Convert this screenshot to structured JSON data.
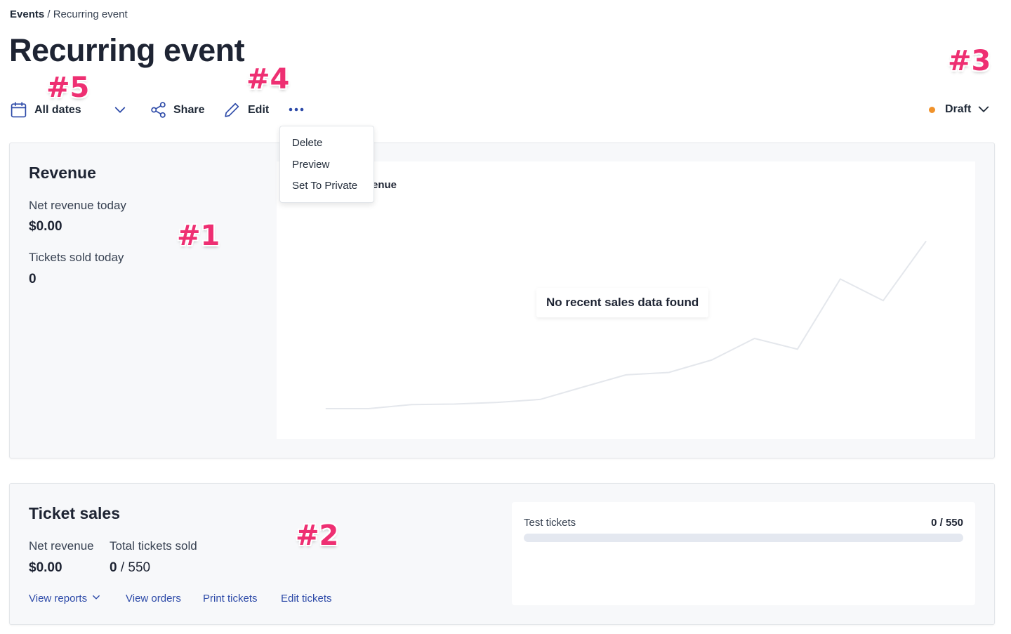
{
  "breadcrumb": {
    "root": "Events",
    "separator": " / ",
    "current": "Recurring event"
  },
  "page": {
    "title": "Recurring event"
  },
  "toolbar": {
    "dates_label": "All dates",
    "share_label": "Share",
    "edit_label": "Edit",
    "more_icon": "ellipsis-icon",
    "status_label": "Draft",
    "status_color": "#f0922b"
  },
  "more_menu": {
    "items": [
      "Delete",
      "Preview",
      "Set To Private"
    ]
  },
  "markers": {
    "m1": "#1",
    "m2": "#2",
    "m3": "#3",
    "m4": "#4",
    "m5": "#5"
  },
  "revenue": {
    "title": "Revenue",
    "net_revenue_label": "Net revenue today",
    "net_revenue_value": "$0.00",
    "tickets_sold_label": "Tickets sold today",
    "tickets_sold_value": "0",
    "chart_heading_visible": "enue",
    "empty_message": "No recent sales data found"
  },
  "chart_data": {
    "type": "line",
    "placeholder": true,
    "values": [
      0,
      0,
      1.5,
      1.7,
      2.3,
      3.4,
      8,
      12.5,
      13.4,
      18,
      26,
      22,
      48,
      40,
      62
    ],
    "ylim": [
      0,
      65
    ],
    "line_color": "#e4e7ec",
    "grid": false
  },
  "ticket_sales": {
    "title": "Ticket sales",
    "net_revenue_label": "Net revenue",
    "net_revenue_value": "$0.00",
    "total_sold_label": "Total tickets sold",
    "total_sold_value": "0",
    "total_sold_capacity": " / 550",
    "links": {
      "view_reports": "View reports",
      "view_orders": "View orders",
      "print_tickets": "Print tickets",
      "edit_tickets": "Edit tickets"
    },
    "ticket_types": [
      {
        "name": "Test tickets",
        "sold_label": "0 / 550",
        "fill_fraction": 0
      }
    ]
  },
  "colors": {
    "accent": "#2d4aa8",
    "marker": "#ee2f72",
    "heading": "#1e2433"
  }
}
